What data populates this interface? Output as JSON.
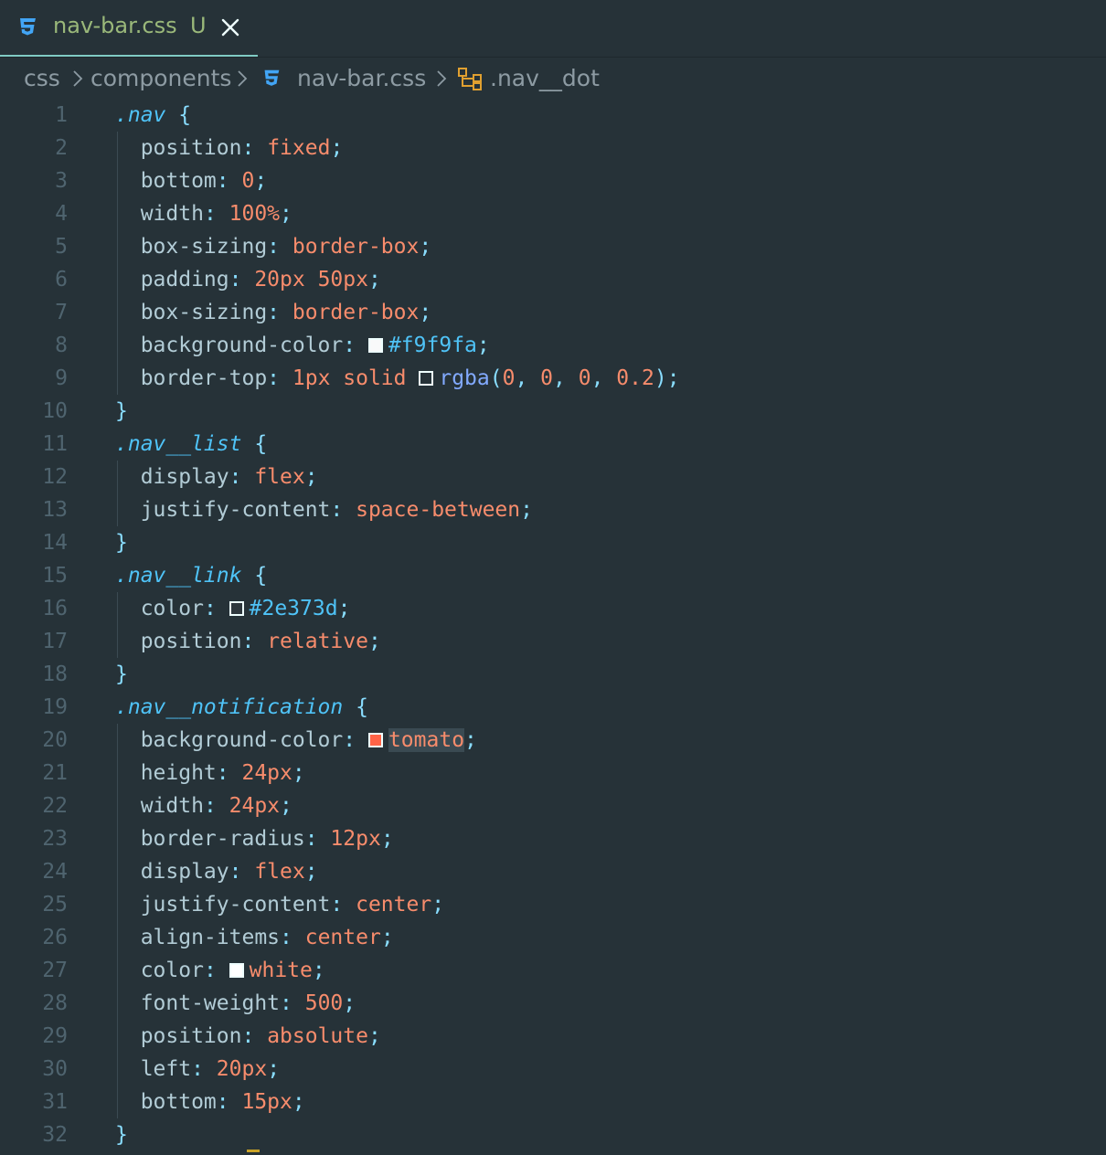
{
  "tab": {
    "filename": "nav-bar.css",
    "status": "U",
    "icon": "css3-icon",
    "close_icon": "close-icon"
  },
  "breadcrumb": {
    "items": [
      "css",
      "components",
      "nav-bar.css",
      ".nav__dot"
    ],
    "icons": [
      "chevron-right-icon",
      "css3-icon",
      "symbol-class-icon"
    ]
  },
  "colors": {
    "editor_bg": "#263238",
    "selector": "#4fc3f7",
    "property": "#b2ccd6",
    "value": "#f78c6c",
    "punctuation": "#89ddff",
    "function": "#82aaff",
    "line_number": "#4f646f",
    "swatch_f9f9fa": "#f9f9fa",
    "swatch_rgba": "rgba(0, 0, 0, 0.2)",
    "swatch_2e373d": "#2e373d",
    "swatch_tomato": "tomato",
    "swatch_white": "white"
  },
  "code": {
    "line_numbers": [
      "1",
      "2",
      "3",
      "4",
      "5",
      "6",
      "7",
      "8",
      "9",
      "10",
      "11",
      "12",
      "13",
      "14",
      "15",
      "16",
      "17",
      "18",
      "19",
      "20",
      "21",
      "22",
      "23",
      "24",
      "25",
      "26",
      "27",
      "28",
      "29",
      "30",
      "31",
      "32"
    ],
    "lines": [
      [
        {
          "t": "sel",
          "v": ".nav"
        },
        {
          "t": "plain",
          "v": " "
        },
        {
          "t": "brace",
          "v": "{"
        }
      ],
      [
        {
          "t": "prop",
          "v": "  position"
        },
        {
          "t": "punc",
          "v": ": "
        },
        {
          "t": "val",
          "v": "fixed"
        },
        {
          "t": "punc",
          "v": ";"
        }
      ],
      [
        {
          "t": "prop",
          "v": "  bottom"
        },
        {
          "t": "punc",
          "v": ": "
        },
        {
          "t": "val",
          "v": "0"
        },
        {
          "t": "punc",
          "v": ";"
        }
      ],
      [
        {
          "t": "prop",
          "v": "  width"
        },
        {
          "t": "punc",
          "v": ": "
        },
        {
          "t": "val",
          "v": "100%"
        },
        {
          "t": "punc",
          "v": ";"
        }
      ],
      [
        {
          "t": "prop",
          "v": "  box-sizing"
        },
        {
          "t": "punc",
          "v": ": "
        },
        {
          "t": "val",
          "v": "border-box"
        },
        {
          "t": "punc",
          "v": ";"
        }
      ],
      [
        {
          "t": "prop",
          "v": "  padding"
        },
        {
          "t": "punc",
          "v": ": "
        },
        {
          "t": "val",
          "v": "20px 50px"
        },
        {
          "t": "punc",
          "v": ";"
        }
      ],
      [
        {
          "t": "prop",
          "v": "  box-sizing"
        },
        {
          "t": "punc",
          "v": ": "
        },
        {
          "t": "val",
          "v": "border-box"
        },
        {
          "t": "punc",
          "v": ";"
        }
      ],
      [
        {
          "t": "prop",
          "v": "  background-color"
        },
        {
          "t": "punc",
          "v": ": "
        },
        {
          "t": "swatch",
          "v": "#f9f9fa"
        },
        {
          "t": "fnhex",
          "v": "#f9f9fa"
        },
        {
          "t": "punc",
          "v": ";"
        }
      ],
      [
        {
          "t": "prop",
          "v": "  border-top"
        },
        {
          "t": "punc",
          "v": ": "
        },
        {
          "t": "val",
          "v": "1px solid "
        },
        {
          "t": "swatch",
          "v": "transparent"
        },
        {
          "t": "fn",
          "v": "rgba"
        },
        {
          "t": "punc",
          "v": "("
        },
        {
          "t": "val",
          "v": "0"
        },
        {
          "t": "punc",
          "v": ", "
        },
        {
          "t": "val",
          "v": "0"
        },
        {
          "t": "punc",
          "v": ", "
        },
        {
          "t": "val",
          "v": "0"
        },
        {
          "t": "punc",
          "v": ", "
        },
        {
          "t": "val",
          "v": "0.2"
        },
        {
          "t": "punc",
          "v": ");"
        }
      ],
      [
        {
          "t": "brace",
          "v": "}"
        }
      ],
      [
        {
          "t": "sel",
          "v": ".nav__list"
        },
        {
          "t": "plain",
          "v": " "
        },
        {
          "t": "brace",
          "v": "{"
        }
      ],
      [
        {
          "t": "prop",
          "v": "  display"
        },
        {
          "t": "punc",
          "v": ": "
        },
        {
          "t": "val",
          "v": "flex"
        },
        {
          "t": "punc",
          "v": ";"
        }
      ],
      [
        {
          "t": "prop",
          "v": "  justify-content"
        },
        {
          "t": "punc",
          "v": ": "
        },
        {
          "t": "val",
          "v": "space-between"
        },
        {
          "t": "punc",
          "v": ";"
        }
      ],
      [
        {
          "t": "brace",
          "v": "}"
        }
      ],
      [
        {
          "t": "sel",
          "v": ".nav__link"
        },
        {
          "t": "plain",
          "v": " "
        },
        {
          "t": "brace",
          "v": "{"
        }
      ],
      [
        {
          "t": "prop",
          "v": "  color"
        },
        {
          "t": "punc",
          "v": ": "
        },
        {
          "t": "swatch",
          "v": "#2e373d"
        },
        {
          "t": "fnhex",
          "v": "#2e373d"
        },
        {
          "t": "punc",
          "v": ";"
        }
      ],
      [
        {
          "t": "prop",
          "v": "  position"
        },
        {
          "t": "punc",
          "v": ": "
        },
        {
          "t": "val",
          "v": "relative"
        },
        {
          "t": "punc",
          "v": ";"
        }
      ],
      [
        {
          "t": "brace",
          "v": "}"
        }
      ],
      [
        {
          "t": "sel",
          "v": ".nav__notification"
        },
        {
          "t": "plain",
          "v": " "
        },
        {
          "t": "brace",
          "v": "{"
        }
      ],
      [
        {
          "t": "prop",
          "v": "  background-color"
        },
        {
          "t": "punc",
          "v": ": "
        },
        {
          "t": "swatch",
          "v": "tomato"
        },
        {
          "t": "valhl",
          "v": "tomato"
        },
        {
          "t": "punc",
          "v": ";"
        }
      ],
      [
        {
          "t": "prop",
          "v": "  height"
        },
        {
          "t": "punc",
          "v": ": "
        },
        {
          "t": "val",
          "v": "24px"
        },
        {
          "t": "punc",
          "v": ";"
        }
      ],
      [
        {
          "t": "prop",
          "v": "  width"
        },
        {
          "t": "punc",
          "v": ": "
        },
        {
          "t": "val",
          "v": "24px"
        },
        {
          "t": "punc",
          "v": ";"
        }
      ],
      [
        {
          "t": "prop",
          "v": "  border-radius"
        },
        {
          "t": "punc",
          "v": ": "
        },
        {
          "t": "val",
          "v": "12px"
        },
        {
          "t": "punc",
          "v": ";"
        }
      ],
      [
        {
          "t": "prop",
          "v": "  display"
        },
        {
          "t": "punc",
          "v": ": "
        },
        {
          "t": "val",
          "v": "flex"
        },
        {
          "t": "punc",
          "v": ";"
        }
      ],
      [
        {
          "t": "prop",
          "v": "  justify-content"
        },
        {
          "t": "punc",
          "v": ": "
        },
        {
          "t": "val",
          "v": "center"
        },
        {
          "t": "punc",
          "v": ";"
        }
      ],
      [
        {
          "t": "prop",
          "v": "  align-items"
        },
        {
          "t": "punc",
          "v": ": "
        },
        {
          "t": "val",
          "v": "center"
        },
        {
          "t": "punc",
          "v": ";"
        }
      ],
      [
        {
          "t": "prop",
          "v": "  color"
        },
        {
          "t": "punc",
          "v": ": "
        },
        {
          "t": "swatch",
          "v": "white"
        },
        {
          "t": "val",
          "v": "white"
        },
        {
          "t": "punc",
          "v": ";"
        }
      ],
      [
        {
          "t": "prop",
          "v": "  font-weight"
        },
        {
          "t": "punc",
          "v": ": "
        },
        {
          "t": "val",
          "v": "500"
        },
        {
          "t": "punc",
          "v": ";"
        }
      ],
      [
        {
          "t": "prop",
          "v": "  position"
        },
        {
          "t": "punc",
          "v": ": "
        },
        {
          "t": "val",
          "v": "absolute"
        },
        {
          "t": "punc",
          "v": ";"
        }
      ],
      [
        {
          "t": "prop",
          "v": "  left"
        },
        {
          "t": "punc",
          "v": ": "
        },
        {
          "t": "val",
          "v": "20px"
        },
        {
          "t": "punc",
          "v": ";"
        }
      ],
      [
        {
          "t": "prop",
          "v": "  bottom"
        },
        {
          "t": "punc",
          "v": ": "
        },
        {
          "t": "val",
          "v": "15px"
        },
        {
          "t": "punc",
          "v": ";"
        }
      ],
      [
        {
          "t": "brace",
          "v": "}"
        }
      ]
    ]
  }
}
